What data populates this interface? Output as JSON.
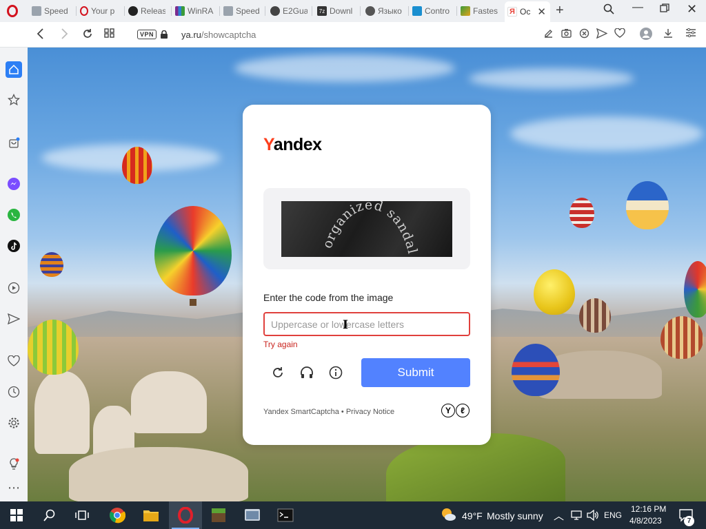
{
  "tabs": [
    {
      "label": "Speed",
      "favicon_color": "#9aa3ad"
    },
    {
      "label": "Your p",
      "favicon_color": "#d3121e"
    },
    {
      "label": "Releas",
      "favicon_color": "#222222"
    },
    {
      "label": "WinRA",
      "favicon_color": "#7b2c8f"
    },
    {
      "label": "Speed",
      "favicon_color": "#9aa3ad"
    },
    {
      "label": "E2Gua",
      "favicon_color": "#444444"
    },
    {
      "label": "Downl",
      "favicon_color": "#333333"
    },
    {
      "label": "Языко",
      "favicon_color": "#555555"
    },
    {
      "label": "Contro",
      "favicon_color": "#1a8fd0"
    },
    {
      "label": "Fastes",
      "favicon_color": "#e2a21a"
    },
    {
      "label": "Oc",
      "favicon_color": "#e8443a"
    }
  ],
  "favicon_texts": {
    "f7z": "7z",
    "yandex": "Я"
  },
  "address": {
    "vpn": "VPN",
    "host": "ya.ru",
    "path": "/showcaptcha"
  },
  "card": {
    "logo_y": "Y",
    "logo_rest": "andex",
    "captcha_text": "organized sandals",
    "prompt": "Enter the code from the image",
    "input_placeholder": "Uppercase or lowercase letters",
    "error": "Try again",
    "submit": "Submit",
    "footer_brand": "Yandex SmartCaptcha",
    "footer_sep": " • ",
    "footer_privacy": "Privacy Notice",
    "badge_1": "Y",
    "badge_2": "ℓ"
  },
  "taskbar": {
    "weather": "49°F",
    "weather_desc": "Mostly sunny",
    "lang": "ENG",
    "time": "12:16 PM",
    "date": "4/8/2023",
    "notifications": "7"
  },
  "colors": {
    "accent": "#5282ff",
    "error": "#c9241e",
    "yandex_red": "#fc3f1d",
    "opera_red": "#d3121e"
  }
}
